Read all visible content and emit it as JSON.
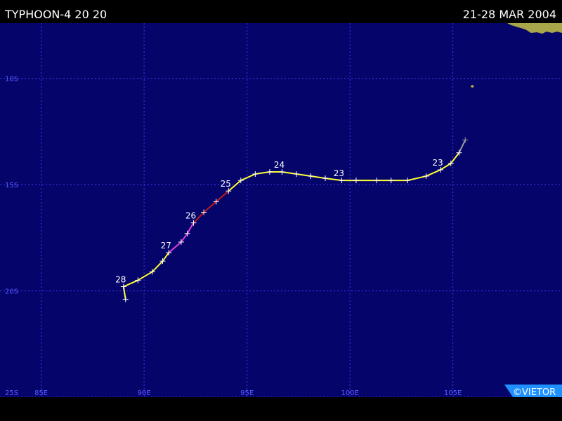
{
  "title": {
    "left": "TYPHOON-4 20 20",
    "right": "21-28 MAR 2004"
  },
  "copyright": "©VIETOR",
  "colors": {
    "ocean": "#04046b",
    "grid": "#3c3cf0",
    "grid_label": "#5a5aff",
    "land": "#a8a84a",
    "track_yellow": "#ffff30",
    "track_red": "#c01a1a",
    "track_magenta": "#e040e0",
    "track_gray": "#9a9a9a",
    "label": "#ffffff"
  },
  "map": {
    "lon_range": [
      83,
      110.3
    ],
    "lat_range": [
      -25,
      -7.4
    ],
    "lat_lines": [
      {
        "value": -10,
        "label": "10S"
      },
      {
        "value": -15,
        "label": "15S"
      },
      {
        "value": -20,
        "label": "20S"
      },
      {
        "value": -25,
        "label": "25S"
      }
    ],
    "lon_lines": [
      {
        "value": 85,
        "label": "85E"
      },
      {
        "value": 90,
        "label": "90E"
      },
      {
        "value": 95,
        "label": "95E"
      },
      {
        "value": 100,
        "label": "100E"
      },
      {
        "value": 105,
        "label": "105E"
      }
    ],
    "track": [
      {
        "lon": 105.6,
        "lat": -12.9,
        "stage": "gray"
      },
      {
        "lon": 105.3,
        "lat": -13.5,
        "stage": "yellow"
      },
      {
        "lon": 104.9,
        "lat": -14.0,
        "stage": "yellow"
      },
      {
        "lon": 104.4,
        "lat": -14.3,
        "stage": "yellow",
        "day": "23"
      },
      {
        "lon": 103.7,
        "lat": -14.6,
        "stage": "yellow"
      },
      {
        "lon": 102.8,
        "lat": -14.8,
        "stage": "yellow"
      },
      {
        "lon": 102.0,
        "lat": -14.8,
        "stage": "yellow"
      },
      {
        "lon": 101.3,
        "lat": -14.8,
        "stage": "yellow"
      },
      {
        "lon": 100.3,
        "lat": -14.8,
        "stage": "yellow"
      },
      {
        "lon": 99.6,
        "lat": -14.8,
        "stage": "yellow",
        "day": "23"
      },
      {
        "lon": 98.8,
        "lat": -14.7,
        "stage": "yellow"
      },
      {
        "lon": 98.1,
        "lat": -14.6,
        "stage": "yellow"
      },
      {
        "lon": 97.4,
        "lat": -14.5,
        "stage": "yellow"
      },
      {
        "lon": 96.7,
        "lat": -14.4,
        "stage": "yellow",
        "day": "24"
      },
      {
        "lon": 96.1,
        "lat": -14.4,
        "stage": "yellow"
      },
      {
        "lon": 95.4,
        "lat": -14.5,
        "stage": "yellow"
      },
      {
        "lon": 94.7,
        "lat": -14.8,
        "stage": "yellow"
      },
      {
        "lon": 94.1,
        "lat": -15.3,
        "stage": "yellow",
        "day": "25"
      },
      {
        "lon": 93.5,
        "lat": -15.8,
        "stage": "red"
      },
      {
        "lon": 92.9,
        "lat": -16.3,
        "stage": "red"
      },
      {
        "lon": 92.4,
        "lat": -16.8,
        "stage": "red",
        "day": "26"
      },
      {
        "lon": 92.1,
        "lat": -17.3,
        "stage": "magenta"
      },
      {
        "lon": 91.8,
        "lat": -17.7,
        "stage": "magenta"
      },
      {
        "lon": 91.2,
        "lat": -18.2,
        "stage": "magenta",
        "day": "27"
      },
      {
        "lon": 90.9,
        "lat": -18.6,
        "stage": "yellow"
      },
      {
        "lon": 90.4,
        "lat": -19.1,
        "stage": "yellow"
      },
      {
        "lon": 89.7,
        "lat": -19.5,
        "stage": "yellow"
      },
      {
        "lon": 89.0,
        "lat": -19.8,
        "stage": "yellow",
        "day": "28"
      },
      {
        "lon": 89.1,
        "lat": -20.4,
        "stage": "yellow"
      }
    ]
  }
}
